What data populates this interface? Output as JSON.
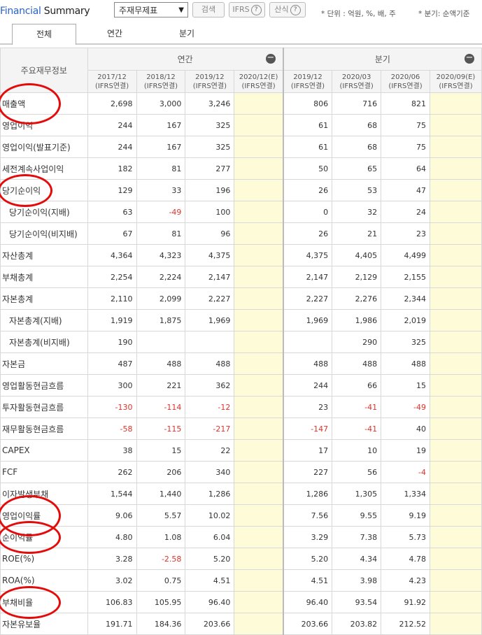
{
  "header": {
    "title_prefix": "Financial",
    "title_suffix": "Summary",
    "select_value": "주재무제표",
    "search_label": "검색",
    "ifrs_label": "IFRS",
    "formula_label": "산식",
    "unit_note": "* 단위 : 억원, %, 배, 주",
    "quarter_note": "* 분기: 순액기준"
  },
  "tabs": [
    "전체",
    "연간",
    "분기"
  ],
  "table": {
    "row_header": "주요재무정보",
    "annual_group": "연간",
    "quarter_group": "분기",
    "collapse_symbol": "−",
    "columns": [
      {
        "period": "2017/12",
        "basis": "(IFRS연결)"
      },
      {
        "period": "2018/12",
        "basis": "(IFRS연결)"
      },
      {
        "period": "2019/12",
        "basis": "(IFRS연결)"
      },
      {
        "period": "2020/12(E)",
        "basis": "(IFRS연결)"
      },
      {
        "period": "2019/12",
        "basis": "(IFRS연결)"
      },
      {
        "period": "2020/03",
        "basis": "(IFRS연결)"
      },
      {
        "period": "2020/06",
        "basis": "(IFRS연결)"
      },
      {
        "period": "2020/09(E)",
        "basis": "(IFRS연결)"
      }
    ],
    "rows": [
      {
        "label": "매출액",
        "sub": false,
        "values": [
          "2,698",
          "3,000",
          "3,246",
          "",
          "806",
          "716",
          "821",
          ""
        ]
      },
      {
        "label": "영업이익",
        "sub": false,
        "values": [
          "244",
          "167",
          "325",
          "",
          "61",
          "68",
          "75",
          ""
        ]
      },
      {
        "label": "영업이익(발표기준)",
        "sub": false,
        "values": [
          "244",
          "167",
          "325",
          "",
          "61",
          "68",
          "75",
          ""
        ]
      },
      {
        "label": "세전계속사업이익",
        "sub": false,
        "values": [
          "182",
          "81",
          "277",
          "",
          "50",
          "65",
          "64",
          ""
        ]
      },
      {
        "label": "당기순이익",
        "sub": false,
        "values": [
          "129",
          "33",
          "196",
          "",
          "26",
          "53",
          "47",
          ""
        ]
      },
      {
        "label": "당기순이익(지배)",
        "sub": true,
        "values": [
          "63",
          "-49",
          "100",
          "",
          "0",
          "32",
          "24",
          ""
        ]
      },
      {
        "label": "당기순이익(비지배)",
        "sub": true,
        "values": [
          "67",
          "81",
          "96",
          "",
          "26",
          "21",
          "23",
          ""
        ]
      },
      {
        "label": "자산총계",
        "sub": false,
        "values": [
          "4,364",
          "4,323",
          "4,375",
          "",
          "4,375",
          "4,405",
          "4,499",
          ""
        ]
      },
      {
        "label": "부채총계",
        "sub": false,
        "values": [
          "2,254",
          "2,224",
          "2,147",
          "",
          "2,147",
          "2,129",
          "2,155",
          ""
        ]
      },
      {
        "label": "자본총계",
        "sub": false,
        "values": [
          "2,110",
          "2,099",
          "2,227",
          "",
          "2,227",
          "2,276",
          "2,344",
          ""
        ]
      },
      {
        "label": "자본총계(지배)",
        "sub": true,
        "values": [
          "1,919",
          "1,875",
          "1,969",
          "",
          "1,969",
          "1,986",
          "2,019",
          ""
        ]
      },
      {
        "label": "자본총계(비지배)",
        "sub": true,
        "values": [
          "190",
          "",
          "",
          "",
          "",
          "290",
          "325",
          ""
        ]
      },
      {
        "label": "자본금",
        "sub": false,
        "values": [
          "487",
          "488",
          "488",
          "",
          "488",
          "488",
          "488",
          ""
        ]
      },
      {
        "label": "영업활동현금흐름",
        "sub": false,
        "values": [
          "300",
          "221",
          "362",
          "",
          "244",
          "66",
          "15",
          ""
        ]
      },
      {
        "label": "투자활동현금흐름",
        "sub": false,
        "values": [
          "-130",
          "-114",
          "-12",
          "",
          "23",
          "-41",
          "-49",
          ""
        ]
      },
      {
        "label": "재무활동현금흐름",
        "sub": false,
        "values": [
          "-58",
          "-115",
          "-217",
          "",
          "-147",
          "-41",
          "40",
          ""
        ]
      },
      {
        "label": "CAPEX",
        "sub": false,
        "values": [
          "38",
          "15",
          "22",
          "",
          "17",
          "10",
          "19",
          ""
        ]
      },
      {
        "label": "FCF",
        "sub": false,
        "values": [
          "262",
          "206",
          "340",
          "",
          "227",
          "56",
          "-4",
          ""
        ]
      },
      {
        "label": "이자발생부채",
        "sub": false,
        "values": [
          "1,544",
          "1,440",
          "1,286",
          "",
          "1,286",
          "1,305",
          "1,334",
          ""
        ]
      },
      {
        "label": "영업이익률",
        "sub": false,
        "values": [
          "9.06",
          "5.57",
          "10.02",
          "",
          "7.56",
          "9.55",
          "9.19",
          ""
        ]
      },
      {
        "label": "순이익률",
        "sub": false,
        "values": [
          "4.80",
          "1.08",
          "6.04",
          "",
          "3.29",
          "7.38",
          "5.73",
          ""
        ]
      },
      {
        "label": "ROE(%)",
        "sub": false,
        "values": [
          "3.28",
          "-2.58",
          "5.20",
          "",
          "5.20",
          "4.34",
          "4.78",
          ""
        ]
      },
      {
        "label": "ROA(%)",
        "sub": false,
        "values": [
          "3.02",
          "0.75",
          "4.51",
          "",
          "4.51",
          "3.98",
          "4.23",
          ""
        ]
      },
      {
        "label": "부채비율",
        "sub": false,
        "values": [
          "106.83",
          "105.95",
          "96.40",
          "",
          "96.40",
          "93.54",
          "91.92",
          ""
        ]
      },
      {
        "label": "자본유보율",
        "sub": false,
        "values": [
          "191.71",
          "184.36",
          "203.66",
          "",
          "203.66",
          "203.82",
          "212.52",
          ""
        ]
      }
    ]
  },
  "annotation_color": "#e40b0b",
  "highlighted_rows": [
    "매출액",
    "당기순이익",
    "영업이익률",
    "순이익률",
    "부채비율"
  ]
}
